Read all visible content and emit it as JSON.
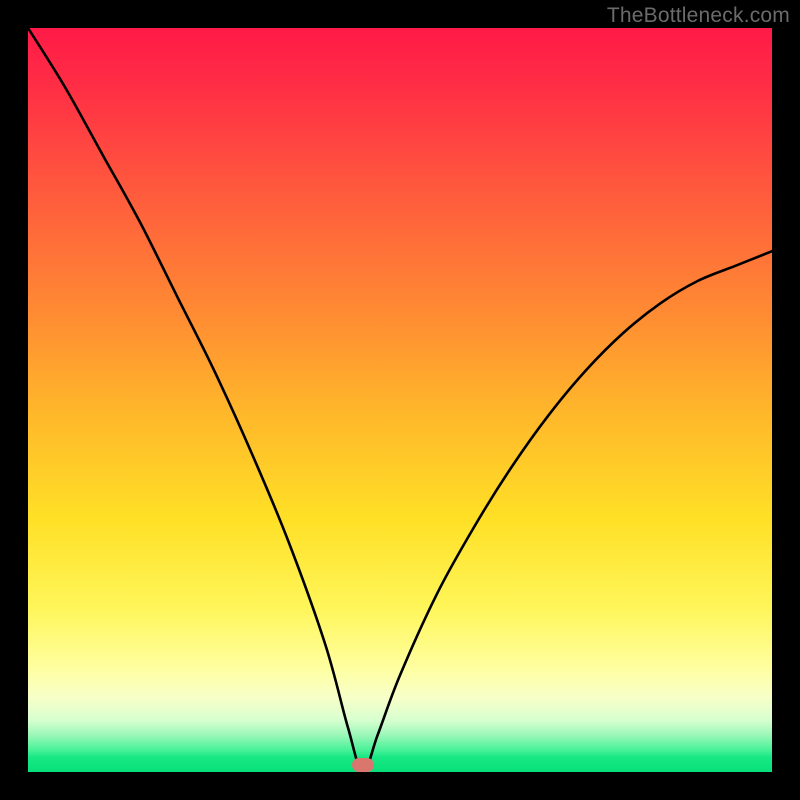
{
  "watermark": "TheBottleneck.com",
  "marker": {
    "x_pct": 45.0,
    "y_pct": 99.0,
    "color": "#d9776f"
  },
  "chart_data": {
    "type": "line",
    "title": "",
    "xlabel": "",
    "ylabel": "",
    "xlim": [
      0,
      100
    ],
    "ylim": [
      0,
      100
    ],
    "grid": false,
    "legend": false,
    "annotations": [
      {
        "text": "TheBottleneck.com",
        "position": "top-right"
      }
    ],
    "background_gradient_note": "vertical color scale red(top)→green(bottom) indicating bottleneck severity",
    "series": [
      {
        "name": "bottleneck-curve",
        "x": [
          0,
          5,
          10,
          15,
          20,
          25,
          30,
          35,
          40,
          43,
          45,
          47,
          50,
          55,
          60,
          65,
          70,
          75,
          80,
          85,
          90,
          95,
          100
        ],
        "values": [
          100,
          92,
          83,
          74,
          64,
          54,
          43,
          31,
          17,
          6,
          0,
          5,
          13,
          24,
          33,
          41,
          48,
          54,
          59,
          63,
          66,
          68,
          70
        ]
      }
    ],
    "minimum_point": {
      "x": 45,
      "y": 0,
      "marker_color": "#d9776f"
    }
  }
}
